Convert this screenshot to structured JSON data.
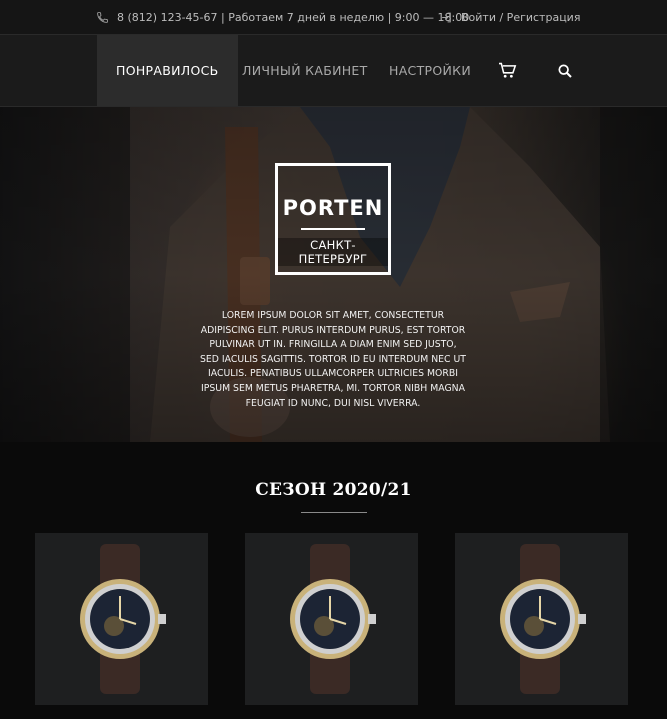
{
  "topbar": {
    "phone_icon": "phone-icon",
    "contact_text": "8 (812) 123-45-67 | Работаем 7 дней в неделю | 9:00 — 18:00",
    "login_icon": "login-icon",
    "auth_text": "Войти / Регистрация"
  },
  "nav": {
    "items": [
      {
        "label": "ПОНРАВИЛОСЬ",
        "active": true
      },
      {
        "label": "ЛИЧНЫЙ КАБИНЕТ",
        "active": false
      },
      {
        "label": "НАСТРОЙКИ",
        "active": false
      }
    ],
    "cart_icon": "cart-icon",
    "search_icon": "search-icon"
  },
  "hero": {
    "brand": "PORTEN",
    "city": "САНКТ-ПЕТЕРБУРГ",
    "description": "LOREM IPSUM DOLOR SIT AMET, CONSECTETUR ADIPISCING ELIT. PURUS INTERDUM PURUS, EST TORTOR PULVINAR UT IN. FRINGILLA A DIAM ENIM SED JUSTO, SED IACULIS SAGITTIS. TORTOR ID EU INTERDUM NEC UT IACULIS. PENATIBUS ULLAMCORPER ULTRICIES MORBI IPSUM SEM METUS PHARETRA, MI. TORTOR NIBH MAGNA FEUGIAT ID NUNC, DUI NISL VIVERRA."
  },
  "season": {
    "title": "СЕЗОН 2020/21"
  },
  "products": [
    {
      "image": "watch-image"
    },
    {
      "image": "watch-image"
    },
    {
      "image": "watch-image"
    }
  ],
  "colors": {
    "background": "#0a0a0a",
    "nav_bg": "#1b1b1b",
    "active_bg": "#2c2c2c",
    "card_bg": "#1e1f20"
  }
}
